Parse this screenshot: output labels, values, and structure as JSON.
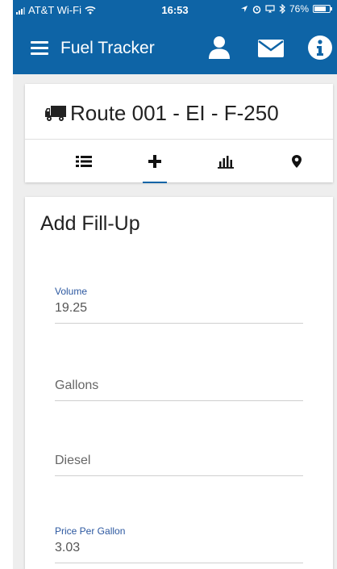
{
  "status_bar": {
    "carrier": "AT&T Wi-Fi",
    "time": "16:53",
    "battery": "76%",
    "battery_level": 0.76
  },
  "app_bar": {
    "title": "Fuel Tracker",
    "icons": [
      "menu-icon",
      "user-icon",
      "mail-icon",
      "info-icon"
    ]
  },
  "route": {
    "title": "Route 001 - EI - F-250",
    "icon": "truck-icon"
  },
  "tabs": [
    {
      "icon": "list-icon",
      "active": false
    },
    {
      "icon": "plus-icon",
      "active": true
    },
    {
      "icon": "bar-chart-icon",
      "active": false
    },
    {
      "icon": "map-marker-icon",
      "active": false
    }
  ],
  "form": {
    "title": "Add Fill-Up",
    "volume": {
      "label": "Volume",
      "value": "19.25"
    },
    "unit": {
      "value": "Gallons"
    },
    "fuel_type": {
      "value": "Diesel"
    },
    "price": {
      "label": "Price Per Gallon",
      "value": "3.03"
    }
  },
  "colors": {
    "primary": "#0e64a6",
    "label": "#2c58a0",
    "background": "#eeeeee"
  }
}
